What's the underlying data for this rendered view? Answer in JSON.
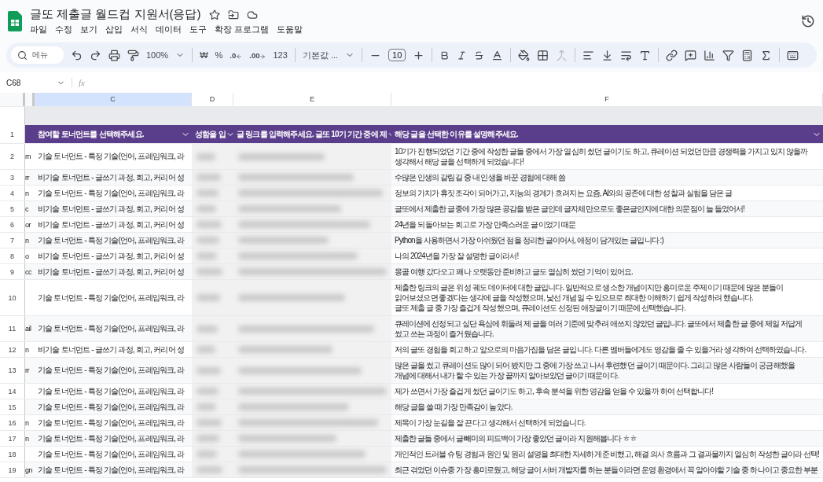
{
  "document": {
    "title": "글또 제출글 월드컵 지원서(응답)"
  },
  "menus": [
    "파일",
    "수정",
    "보기",
    "삽입",
    "서식",
    "데이터",
    "도구",
    "확장 프로그램",
    "도움말"
  ],
  "toolbar": {
    "search_placeholder": "메뉴",
    "zoom": "100%",
    "currency": "₩",
    "percent": "%",
    "decrease_decimal": ".0",
    "increase_decimal": ".00",
    "number_format": "123",
    "font": "기본값 ...",
    "font_size": "10"
  },
  "formula_bar": {
    "cell": "C68",
    "fx": "fx"
  },
  "columns": [
    "C",
    "D",
    "E",
    "F"
  ],
  "header_row": {
    "number": "1",
    "cells": [
      "참여할 토너먼트를 선택해주세요.",
      "성함을 입",
      "글 링크를 입력해주세요. 글또 10기 기간 중에 제",
      "해당 글을 선택한 이유를 설명해주세요."
    ]
  },
  "rows": [
    {
      "number": "2",
      "col_b": "m",
      "col_c": "기술 토너먼트 - 특정 기술(언어, 프레임워크, 라",
      "reason": [
        "10기가 진행되었던 기간 중에 작성한 글들 중에서 가장 열심히 썼던 글이기도 하고, 큐레이션 되었던만큼 경쟁력을 가지고 있지 않을까",
        "생각해서 해당 글을 선택하게 되었습니다!"
      ]
    },
    {
      "number": "3",
      "col_b": "rr",
      "col_c": "비기술 토너먼트 - 글쓰기 과정, 회고, 커리어 성",
      "reason": [
        "수많은 인생의 갈림길 중 내 인생을 바꾼 경험에 대해 씀"
      ]
    },
    {
      "number": "4",
      "col_b": "n",
      "col_c": "기술 토너먼트 - 특정 기술(언어, 프레임워크, 라",
      "reason": [
        "정보의 가치가 휴짓조각이 되어가고, 지능의 경계가 흐려지는 요즘, AI와의 공존에 대한 성찰과 실험을 담은 글"
      ]
    },
    {
      "number": "5",
      "col_b": "c",
      "col_c": "비기술 토너먼트 - 글쓰기 과정, 회고, 커리어 성",
      "reason": [
        "글또에서 제출한 글중에 가장 많은 공감을 받은 글인데 글자체만으로도 좋은글인지에 대한 의문점이 늘 들었어서!"
      ]
    },
    {
      "number": "6",
      "col_b": "or",
      "col_c": "비기술 토너먼트 - 글쓰기 과정, 회고, 커리어 성",
      "reason": [
        "24년을 되돌아보는 회고로 가장 만족스러운 글이었기 때문"
      ]
    },
    {
      "number": "7",
      "col_b": "n",
      "col_c": "기술 토너먼트 - 특정 기술(언어, 프레임워크, 라",
      "reason": [
        "Python을 사용하면서 가장 아쉬웠던 점을 정리한 글이어서, 애정이 담겨있는 글입니다 :)"
      ]
    },
    {
      "number": "8",
      "col_b": "o",
      "col_c": "비기술 토너먼트 - 글쓰기 과정, 회고, 커리어 성",
      "reason": [
        "나의 2024년을 가장 잘 설명한 글이라서!"
      ]
    },
    {
      "number": "9",
      "col_b": "cc",
      "col_c": "비기술 토너먼트 - 글쓰기 과정, 회고, 커리어 성",
      "reason": [
        "몽골 여행 갔다오고 꽤나 오랫동안 준비하고 글도 열심히 썼던 기억이 있어요."
      ]
    },
    {
      "number": "10",
      "col_c": "기술 토너먼트 - 특정 기술(언어, 프레임워크, 라",
      "reason": [
        "제출한 링크의 글은 위성 궤도 데이터에 대한 글입니다. 일반적으로 생소한 개념이지만 흥미로운 주제이기 때문에 많은 분들이",
        "읽어보셨으면 좋겠다는 생각에 글을 작성했으며, 낯선 개념일 수 있으므로 최대한 이해하기 쉽게 작성하려 했습니다.",
        "글또 제출 글 중 가장 즐겁게 작성했으며, 큐레이션도 선정된 애장글이기 때문에 선택했습니다."
      ]
    },
    {
      "number": "11",
      "col_b": "ail",
      "col_c": "기술 토너먼트 - 특정 기술(언어, 프레임워크, 라",
      "reason": [
        "큐레이션에 선정되고 싶단 욕심에 휘둘려 제 글을 여러 기준에 맞추려 애쓰지 않았던 글입니다. 글또에서 제출한 글 중에 제일 저답게",
        "썼고 쓰는 과정이 즐거웠습니다."
      ]
    },
    {
      "number": "12",
      "col_b": "n",
      "col_c": "비기술 토너먼트 - 글쓰기 과정, 회고, 커리어 성",
      "reason": [
        "저의 글또 경험을 회고하고 앞으로의 마음가짐을 담은 글입니다. 다른 멤버들에게도 영감을 줄 수 있을거라 생각하여 선택하였습니다."
      ]
    },
    {
      "number": "13",
      "col_b": "rr",
      "col_c": "기술 토너먼트 - 특정 기술(언어, 프레임워크, 라",
      "reason": [
        "많은 글을 썼고 큐레이션도 많이 되어 봤지만 그 중에 가장 쓰고 나서 후련했던 글이기 때문이다. 그리고 많은 사람들이 궁금해했을",
        "개념에 대해서 내가 할 수 있는 가장 끝까지 알아보았던 글이기 때문이다."
      ]
    },
    {
      "number": "14",
      "col_c": "기술 토너먼트 - 특정 기술(언어, 프레임워크, 라",
      "reason": [
        "제가 쓰면서 가장 즐겁게 썼던 글이기도 하고, 후속 분석을 위한 영감을 얻을 수 있을까 하여 선택합니다!"
      ]
    },
    {
      "number": "15",
      "col_c": "기술 토너먼트 - 특정 기술(언어, 프레임워크, 라",
      "reason": [
        "해당 글을 쓸 때 가장 만족감이 높았다."
      ]
    },
    {
      "number": "16",
      "col_b": "n",
      "col_c": "기술 토너먼트 - 특정 기술(언어, 프레임워크, 라",
      "reason": [
        "제목이 가장 눈길을 잘 끈다고 생각해서 선택하게 되었습니다."
      ]
    },
    {
      "number": "17",
      "col_b": "n",
      "col_c": "기술 토너먼트 - 특정 기술(언어, 프레임워크, 라",
      "reason": [
        "제출한 글들 중에서 글빼미의 피드백이 가장 좋았던 글이라 지원해봅니다 ㅎㅎ"
      ]
    },
    {
      "number": "18",
      "col_c": "기술 토너먼트 - 특정 기술(언어, 프레임워크, 라",
      "reason": [
        "개인적인 트러블 슈팅 경험과 원인 및 원리 설명을 최대한 자세하게 준비했고, 해결 의사 흐름과 그 결과물까지 열심히 작성한 글이라 선택!"
      ]
    },
    {
      "number": "19",
      "col_b": "gn",
      "col_c": "기술 토너먼트 - 특정 기술(언어, 프레임워크, 라",
      "reason": [
        "최근 겪었던 이슈중 가장 흥미로웠고, 해당 글이 서버 개발자를 하는 분들이라면 운영 환경에서 꼭 알아야할 기술 중 하나이고 중요한 부분"
      ]
    }
  ]
}
